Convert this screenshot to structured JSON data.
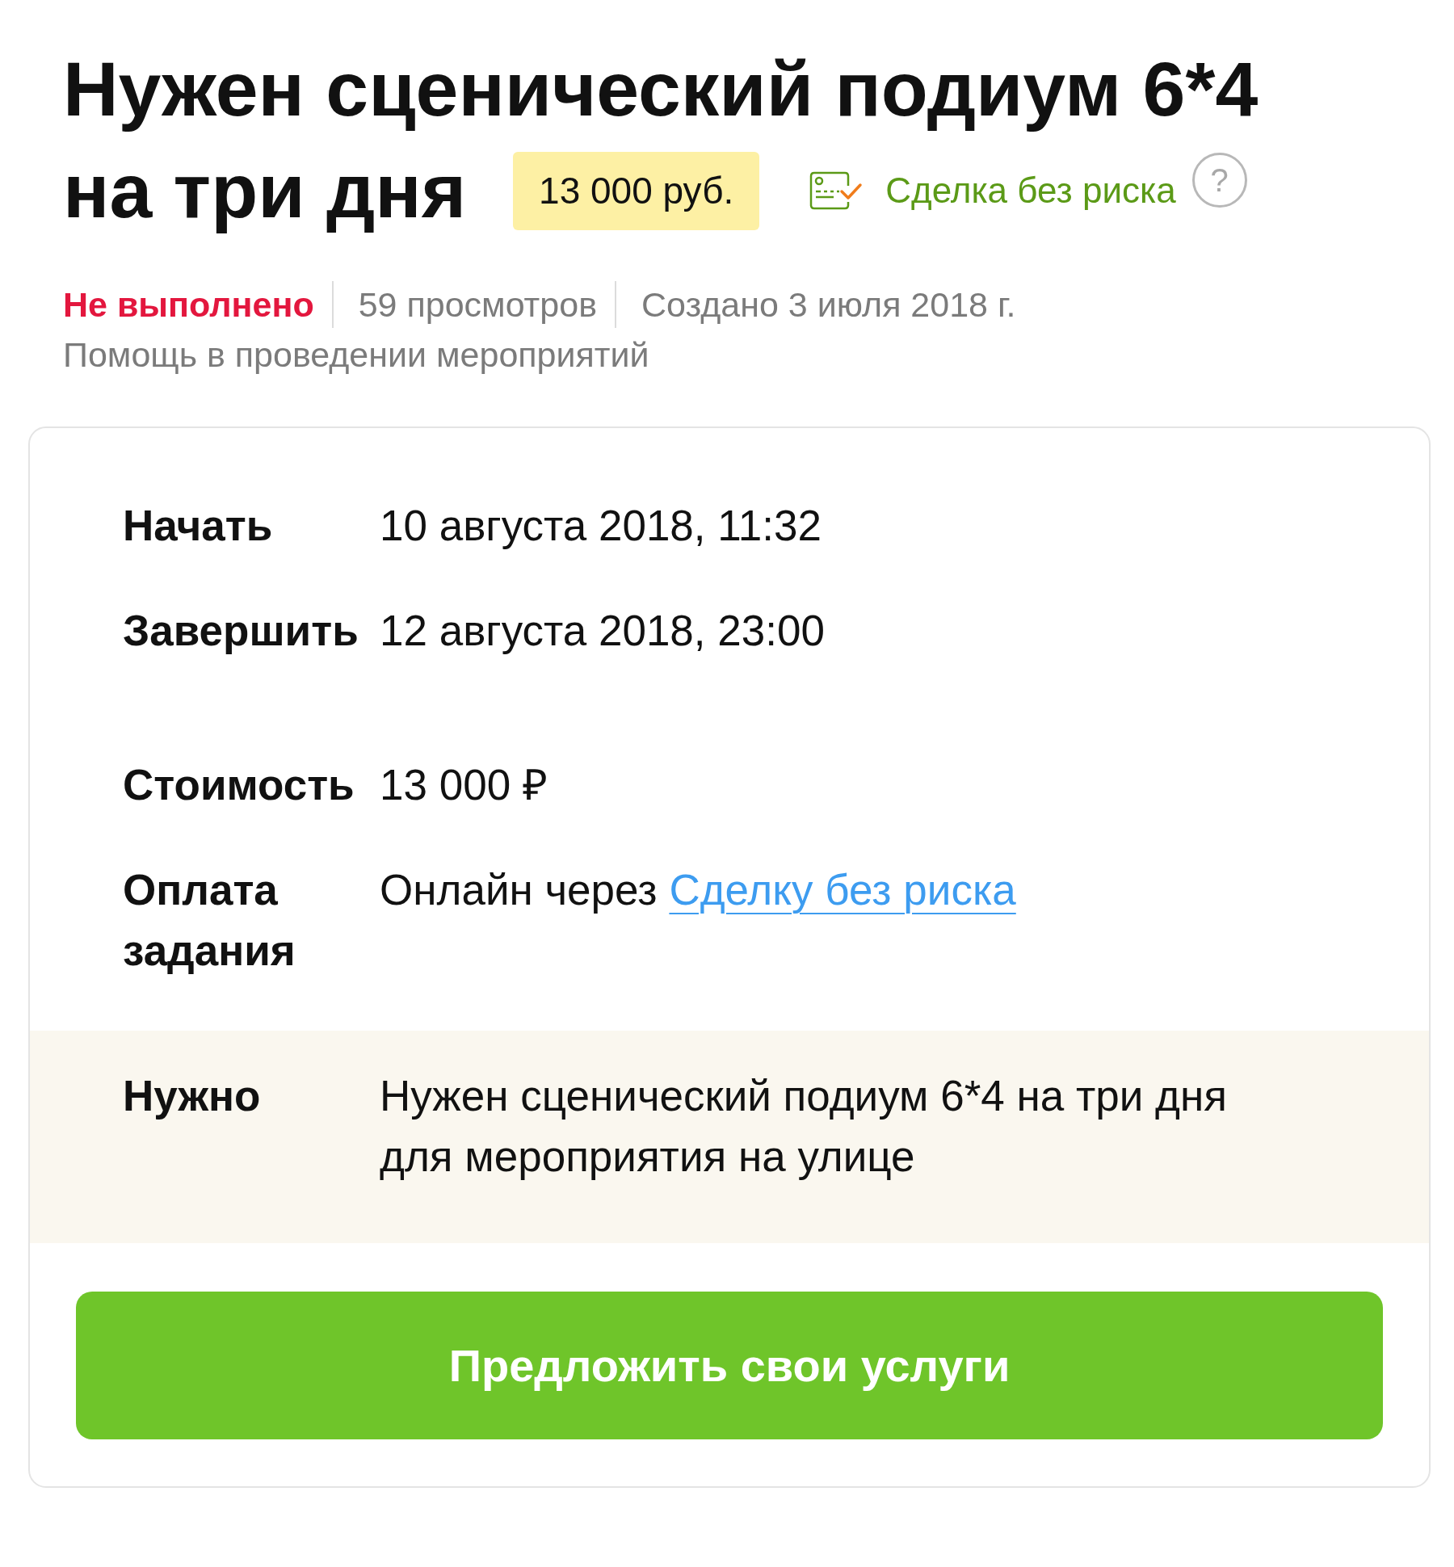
{
  "title": {
    "lines": [
      "Нужен сценический подиум 6*4",
      "на три дня"
    ],
    "price": "13 000 руб.",
    "safe_deal": "Сделка без риска",
    "help": "?"
  },
  "meta": {
    "status": "Не выполнено",
    "views": "59 просмотров",
    "created": "Создано 3 июля 2018 г.",
    "category": "Помощь в проведении мероприятий"
  },
  "card": {
    "groups": [
      {
        "rows": [
          {
            "label": "Начать",
            "value": "10 августа 2018, 11:32"
          },
          {
            "label": "Завершить",
            "value": "12 августа 2018, 23:00"
          }
        ]
      },
      {
        "rows": [
          {
            "label": "Стоимость",
            "value": "13 000 ₽"
          },
          {
            "label": "Оплата задания",
            "value": "Онлайн через",
            "link": "Сделку без риска"
          }
        ]
      }
    ],
    "description": {
      "label": "Нужно",
      "value": "Нужен сценический подиум 6*4 на три дня для мероприятия на улице"
    },
    "action_button": "Предложить свои услуги"
  }
}
